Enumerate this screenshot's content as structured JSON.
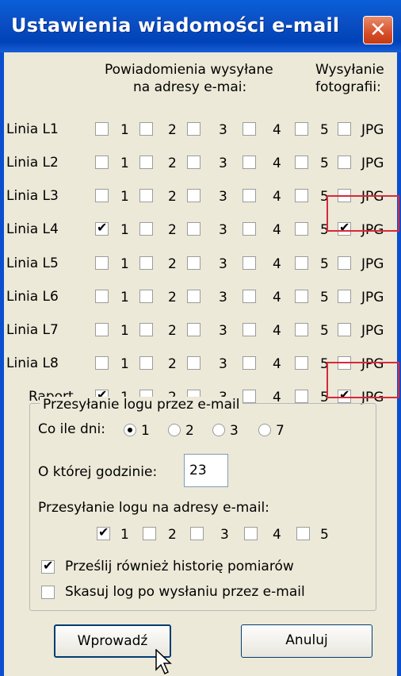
{
  "window": {
    "title": "Ustawienia wiadomości e-mail"
  },
  "header": {
    "notify_line1": "Powiadomienia wysyłane",
    "notify_line2": "na adresy e-mai:",
    "photo_line1": "Wysyłanie",
    "photo_line2": "fotografii:"
  },
  "numbers": [
    "1",
    "2",
    "3",
    "4",
    "5"
  ],
  "jpg_label": "JPG",
  "rows": [
    {
      "label": "Linia L1",
      "checks": [
        false,
        false,
        false,
        false,
        false
      ],
      "jpg": false
    },
    {
      "label": "Linia L2",
      "checks": [
        false,
        false,
        false,
        false,
        false
      ],
      "jpg": false
    },
    {
      "label": "Linia L3",
      "checks": [
        false,
        false,
        false,
        false,
        false
      ],
      "jpg": false
    },
    {
      "label": "Linia L4",
      "checks": [
        true,
        false,
        false,
        false,
        false
      ],
      "jpg": true
    },
    {
      "label": "Linia L5",
      "checks": [
        false,
        false,
        false,
        false,
        false
      ],
      "jpg": false
    },
    {
      "label": "Linia L6",
      "checks": [
        false,
        false,
        false,
        false,
        false
      ],
      "jpg": false
    },
    {
      "label": "Linia L7",
      "checks": [
        false,
        false,
        false,
        false,
        false
      ],
      "jpg": false
    },
    {
      "label": "Linia L8",
      "checks": [
        false,
        false,
        false,
        false,
        false
      ],
      "jpg": false
    },
    {
      "label": "Raport",
      "checks": [
        true,
        false,
        false,
        false,
        false
      ],
      "jpg": true
    }
  ],
  "log_group": {
    "title": "Przesyłanie logu przez e-mail",
    "interval_label": "Co ile dni:",
    "interval_options": [
      "1",
      "2",
      "3",
      "7"
    ],
    "interval_selected": "1",
    "hour_label": "O której godzinie:",
    "hour_value": "23",
    "addresses_label": "Przesyłanie logu na adresy e-mail:",
    "address_checks": [
      true,
      false,
      false,
      false,
      false
    ],
    "send_history_label": "Prześlij również historię pomiarów",
    "send_history_checked": true,
    "delete_log_label": "Skasuj log po wysłaniu przez e-mail",
    "delete_log_checked": false
  },
  "buttons": {
    "ok": "Wprowadź",
    "cancel": "Anuluj"
  },
  "colors": {
    "titlebar": "#0a4fcf",
    "highlight": "#d8283a",
    "dialog_bg": "#ece9d8"
  }
}
